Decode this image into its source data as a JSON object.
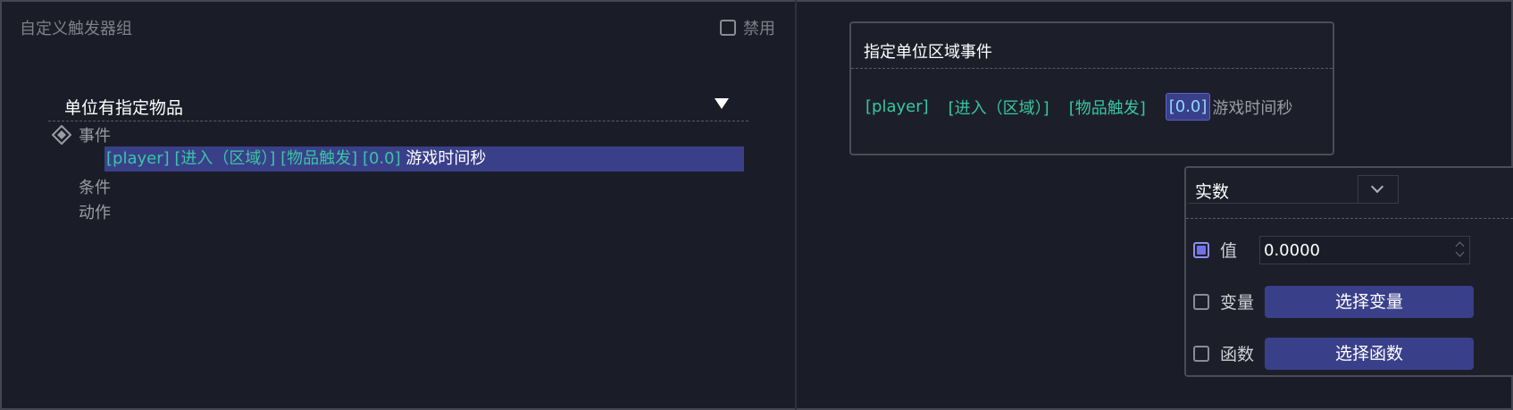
{
  "left_panel": {
    "title": "自定义触发器组",
    "disable_label": "禁用",
    "disable_checked": false,
    "trigger": {
      "name": "单位有指定物品",
      "sections": {
        "event_label": "事件",
        "condition_label": "条件",
        "action_label": "动作"
      },
      "event_line": {
        "player": "[player]",
        "enter_region": "[进入（区域）]",
        "item_trigger": "[物品触发]",
        "time_value": "[0.0]",
        "time_unit": "游戏时间秒"
      }
    }
  },
  "event_editor": {
    "title": "指定单位区域事件",
    "params": {
      "player": "[player]",
      "enter_region": "[进入（区域）]",
      "item_trigger": "[物品触发]",
      "time_value": "[0.0]",
      "time_unit": "游戏时间秒"
    }
  },
  "value_panel": {
    "type_selected": "实数",
    "options": {
      "value_label": "值",
      "value_checked": true,
      "value_input": "0.0000",
      "variable_label": "变量",
      "variable_checked": false,
      "variable_button": "选择变量",
      "function_label": "函数",
      "function_checked": false,
      "function_button": "选择函数"
    }
  },
  "colors": {
    "background": "#1a1d27",
    "accent": "#3a3f8a",
    "param_teal": "#39c6a2",
    "checkbox_active": "#6e71e8"
  },
  "icons": {
    "event_section": "diamond-event-icon",
    "dropdown": "triangle-down-icon",
    "type_chevron": "chevron-down-icon"
  }
}
